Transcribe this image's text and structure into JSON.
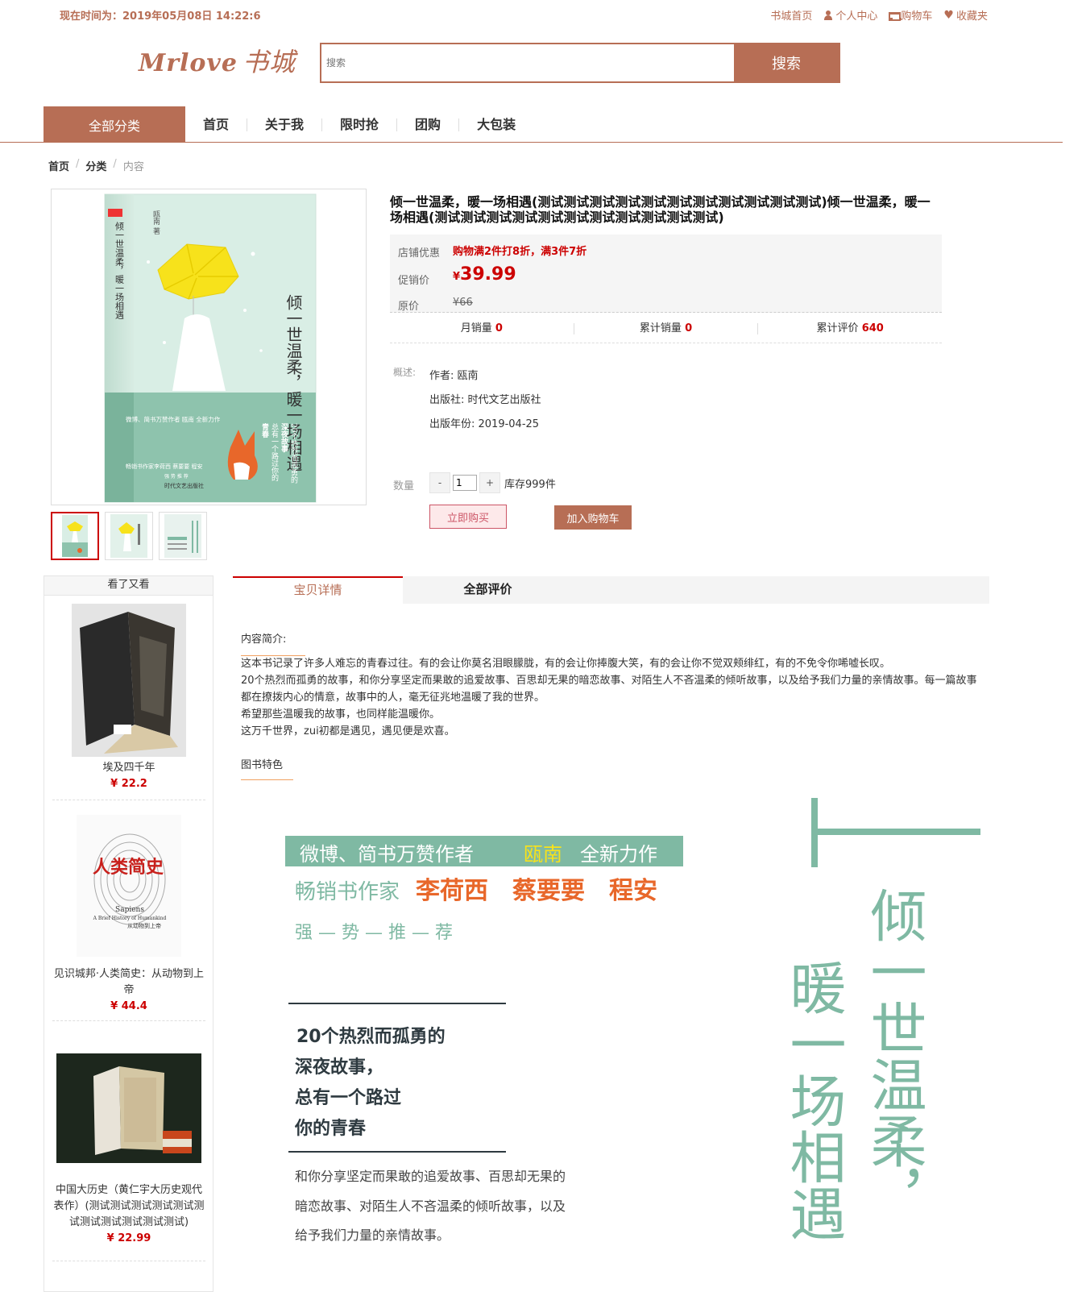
{
  "topbar": {
    "time": "现在时间为：2019年05月08日 14:22:6",
    "links": [
      "书城首页",
      "个人中心",
      "购物车",
      "收藏夹"
    ]
  },
  "logo": {
    "en": "Mrlove",
    "cn": "书城"
  },
  "search": {
    "placeholder": "搜索",
    "button": "搜索"
  },
  "nav": {
    "all": "全部分类",
    "items": [
      "首页",
      "关于我",
      "限时抢",
      "团购",
      "大包装"
    ]
  },
  "breadcrumb": [
    "首页",
    "分类",
    "内容"
  ],
  "product": {
    "title": "倾一世温柔，暖一场相遇(测试测试测试测试测试测试测试测试测试测试测试)倾一世温柔，暖一场相遇(测试测试测试测试测试测试测试测试测试测试测试)",
    "promo_label": "店铺优惠",
    "promo_text": "购物满2件打8折，满3件7折",
    "price_label": "促销价",
    "currency": "¥",
    "price": "39.99",
    "orig_label": "原价",
    "orig_price": "¥66",
    "monthly_label": "月销量",
    "monthly": "0",
    "total_label": "累计销量",
    "total": "0",
    "reviews_label": "累计评价",
    "reviews": "640",
    "desc_label": "概述:",
    "author": "作者: 瓯南",
    "publisher": "出版社: 时代文艺出版社",
    "year": "出版年份: 2019-04-25",
    "qty_label": "数量",
    "qty_minus": "-",
    "qty_value": "1",
    "qty_plus": "+",
    "stock": "库存999件",
    "buy": "立即购买",
    "add_cart": "加入购物车"
  },
  "cover": {
    "title_v": "倾一世温柔，暖一场相遇",
    "author_v": "瓯南 著",
    "band": "微博、简书万赞作者 瓯南 全新力作",
    "story1": "20个热烈而孤勇的",
    "story2": "深夜故事",
    "story3": "总有一个路过你的",
    "story4": "青春",
    "rec": "畅销书作家李荷西 蔡要要 程安",
    "rec2": "强 势 推 荐",
    "publisher": "时代文艺出版社"
  },
  "sidebar": {
    "header": "看了又看",
    "items": [
      {
        "name": "埃及四千年",
        "price": "¥ 22.2"
      },
      {
        "name": "见识城邦·人类简史：从动物到上帝",
        "price": "¥ 44.4",
        "cover_title": "人类简史",
        "cover_en": "Sapiens",
        "cover_sub": "A Brief History of Humankind",
        "cover_sub2": "从动物到上帝"
      },
      {
        "name": "中国大历史（黄仁宇大历史观代表作）(测试测试测试测试测试测试测试测试测试测试测试)",
        "price": "¥ 22.99"
      }
    ]
  },
  "tabs": {
    "detail": "宝贝详情",
    "reviews": "全部评价"
  },
  "content": {
    "intro_title": "内容简介:",
    "paragraphs": [
      "这本书记录了许多人难忘的青春过往。有的会让你莫名泪眼朦胧，有的会让你捧腹大笑，有的会让你不觉双颊绯红，有的不免令你唏嘘长叹。",
      "20个热烈而孤勇的故事，和你分享坚定而果敢的追爱故事、百思却无果的暗恋故事、对陌生人不吝温柔的倾听故事，以及给予我们力量的亲情故事。每一篇故事都在撩拨内心的情意，故事中的人，毫无征兆地温暖了我的世界。",
      "希望那些温暖我的故事，也同样能温暖你。",
      "这万千世界，zui初都是遇见，遇见便是欢喜。"
    ],
    "features_title": "图书特色"
  },
  "feature_img": {
    "band_a": "微博、简书万赞作者",
    "band_name": "瓯南",
    "band_b": "全新力作",
    "rec_a": "畅销书作家",
    "rec_names": "李荷西　蔡要要　程安",
    "rec_b": "强 — 势 — 推 — 荐",
    "s1": "20个热烈而孤勇的",
    "s2": "深夜故事，",
    "s3": "总有一个路过",
    "s4": "你的青春",
    "p1": "和你分享坚定而果敢的追爱故事、百思却无果的",
    "p2": "暗恋故事、对陌生人不吝温柔的倾听故事，以及",
    "p3": "给予我们力量的亲情故事。",
    "v1": "倾一世温柔，",
    "v2": "暖一场相遇"
  },
  "colors": {
    "accent": "#b76e55",
    "price": "#cc0000",
    "mint": "#7fb9a3"
  }
}
